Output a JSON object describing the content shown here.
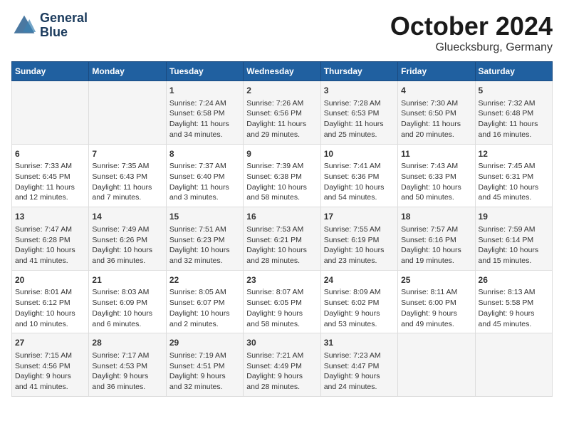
{
  "header": {
    "logo_line1": "General",
    "logo_line2": "Blue",
    "month": "October 2024",
    "location": "Gluecksburg, Germany"
  },
  "weekdays": [
    "Sunday",
    "Monday",
    "Tuesday",
    "Wednesday",
    "Thursday",
    "Friday",
    "Saturday"
  ],
  "weeks": [
    [
      {
        "day": "",
        "info": ""
      },
      {
        "day": "",
        "info": ""
      },
      {
        "day": "1",
        "info": "Sunrise: 7:24 AM\nSunset: 6:58 PM\nDaylight: 11 hours\nand 34 minutes."
      },
      {
        "day": "2",
        "info": "Sunrise: 7:26 AM\nSunset: 6:56 PM\nDaylight: 11 hours\nand 29 minutes."
      },
      {
        "day": "3",
        "info": "Sunrise: 7:28 AM\nSunset: 6:53 PM\nDaylight: 11 hours\nand 25 minutes."
      },
      {
        "day": "4",
        "info": "Sunrise: 7:30 AM\nSunset: 6:50 PM\nDaylight: 11 hours\nand 20 minutes."
      },
      {
        "day": "5",
        "info": "Sunrise: 7:32 AM\nSunset: 6:48 PM\nDaylight: 11 hours\nand 16 minutes."
      }
    ],
    [
      {
        "day": "6",
        "info": "Sunrise: 7:33 AM\nSunset: 6:45 PM\nDaylight: 11 hours\nand 12 minutes."
      },
      {
        "day": "7",
        "info": "Sunrise: 7:35 AM\nSunset: 6:43 PM\nDaylight: 11 hours\nand 7 minutes."
      },
      {
        "day": "8",
        "info": "Sunrise: 7:37 AM\nSunset: 6:40 PM\nDaylight: 11 hours\nand 3 minutes."
      },
      {
        "day": "9",
        "info": "Sunrise: 7:39 AM\nSunset: 6:38 PM\nDaylight: 10 hours\nand 58 minutes."
      },
      {
        "day": "10",
        "info": "Sunrise: 7:41 AM\nSunset: 6:36 PM\nDaylight: 10 hours\nand 54 minutes."
      },
      {
        "day": "11",
        "info": "Sunrise: 7:43 AM\nSunset: 6:33 PM\nDaylight: 10 hours\nand 50 minutes."
      },
      {
        "day": "12",
        "info": "Sunrise: 7:45 AM\nSunset: 6:31 PM\nDaylight: 10 hours\nand 45 minutes."
      }
    ],
    [
      {
        "day": "13",
        "info": "Sunrise: 7:47 AM\nSunset: 6:28 PM\nDaylight: 10 hours\nand 41 minutes."
      },
      {
        "day": "14",
        "info": "Sunrise: 7:49 AM\nSunset: 6:26 PM\nDaylight: 10 hours\nand 36 minutes."
      },
      {
        "day": "15",
        "info": "Sunrise: 7:51 AM\nSunset: 6:23 PM\nDaylight: 10 hours\nand 32 minutes."
      },
      {
        "day": "16",
        "info": "Sunrise: 7:53 AM\nSunset: 6:21 PM\nDaylight: 10 hours\nand 28 minutes."
      },
      {
        "day": "17",
        "info": "Sunrise: 7:55 AM\nSunset: 6:19 PM\nDaylight: 10 hours\nand 23 minutes."
      },
      {
        "day": "18",
        "info": "Sunrise: 7:57 AM\nSunset: 6:16 PM\nDaylight: 10 hours\nand 19 minutes."
      },
      {
        "day": "19",
        "info": "Sunrise: 7:59 AM\nSunset: 6:14 PM\nDaylight: 10 hours\nand 15 minutes."
      }
    ],
    [
      {
        "day": "20",
        "info": "Sunrise: 8:01 AM\nSunset: 6:12 PM\nDaylight: 10 hours\nand 10 minutes."
      },
      {
        "day": "21",
        "info": "Sunrise: 8:03 AM\nSunset: 6:09 PM\nDaylight: 10 hours\nand 6 minutes."
      },
      {
        "day": "22",
        "info": "Sunrise: 8:05 AM\nSunset: 6:07 PM\nDaylight: 10 hours\nand 2 minutes."
      },
      {
        "day": "23",
        "info": "Sunrise: 8:07 AM\nSunset: 6:05 PM\nDaylight: 9 hours\nand 58 minutes."
      },
      {
        "day": "24",
        "info": "Sunrise: 8:09 AM\nSunset: 6:02 PM\nDaylight: 9 hours\nand 53 minutes."
      },
      {
        "day": "25",
        "info": "Sunrise: 8:11 AM\nSunset: 6:00 PM\nDaylight: 9 hours\nand 49 minutes."
      },
      {
        "day": "26",
        "info": "Sunrise: 8:13 AM\nSunset: 5:58 PM\nDaylight: 9 hours\nand 45 minutes."
      }
    ],
    [
      {
        "day": "27",
        "info": "Sunrise: 7:15 AM\nSunset: 4:56 PM\nDaylight: 9 hours\nand 41 minutes."
      },
      {
        "day": "28",
        "info": "Sunrise: 7:17 AM\nSunset: 4:53 PM\nDaylight: 9 hours\nand 36 minutes."
      },
      {
        "day": "29",
        "info": "Sunrise: 7:19 AM\nSunset: 4:51 PM\nDaylight: 9 hours\nand 32 minutes."
      },
      {
        "day": "30",
        "info": "Sunrise: 7:21 AM\nSunset: 4:49 PM\nDaylight: 9 hours\nand 28 minutes."
      },
      {
        "day": "31",
        "info": "Sunrise: 7:23 AM\nSunset: 4:47 PM\nDaylight: 9 hours\nand 24 minutes."
      },
      {
        "day": "",
        "info": ""
      },
      {
        "day": "",
        "info": ""
      }
    ]
  ]
}
